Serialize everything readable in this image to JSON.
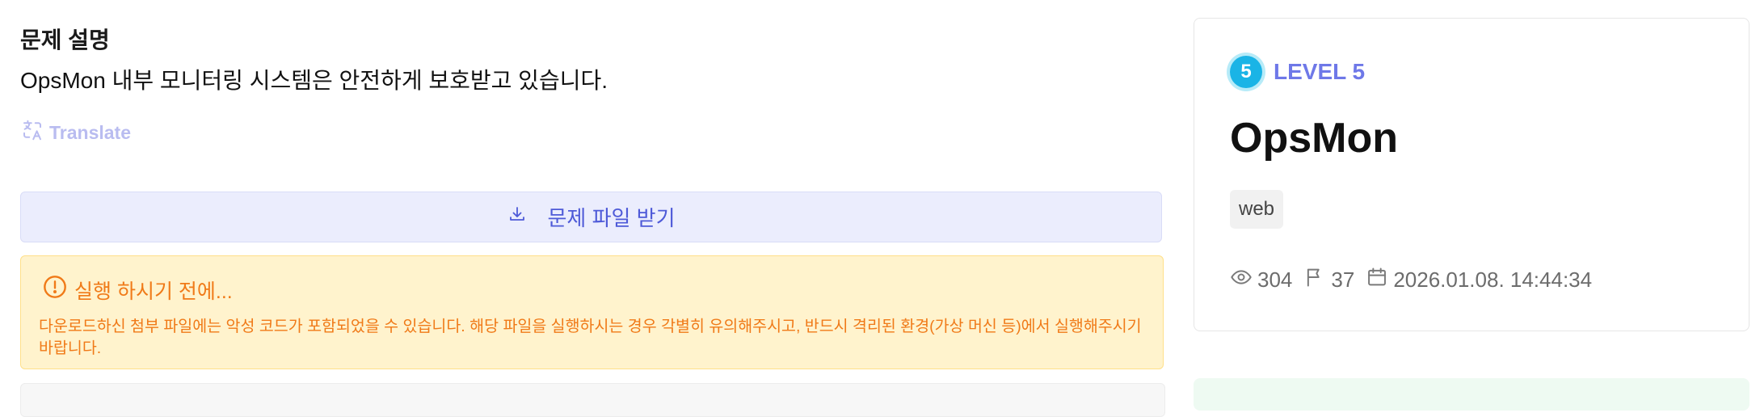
{
  "problem": {
    "section_title": "문제 설명",
    "description": "OpsMon 내부 모니터링 시스템은 안전하게 보호받고 있습니다.",
    "translate_label": "Translate",
    "download_label": "문제 파일 받기"
  },
  "warning": {
    "title": "실행 하시기 전에...",
    "body": "다운로드하신 첨부 파일에는 악성 코드가 포함되었을 수 있습니다. 해당 파일을 실행하시는 경우 각별히 유의해주시고, 반드시 격리된 환경(가상 머신 등)에서 실행해주시기 바랍니다."
  },
  "challenge": {
    "level_number": "5",
    "level_label": "LEVEL 5",
    "title": "OpsMon",
    "tag": "web",
    "views": "304",
    "solves": "37",
    "date": "2026.01.08. 14:44:34"
  },
  "colors": {
    "accent": "#4e5ad8",
    "level_badge": "#1ab4e6",
    "warning_text": "#f07a18",
    "warning_bg": "#fff3cd"
  },
  "icons": [
    "translate-icon",
    "download-icon",
    "alert-circle-icon",
    "eye-icon",
    "flag-icon",
    "calendar-icon"
  ]
}
